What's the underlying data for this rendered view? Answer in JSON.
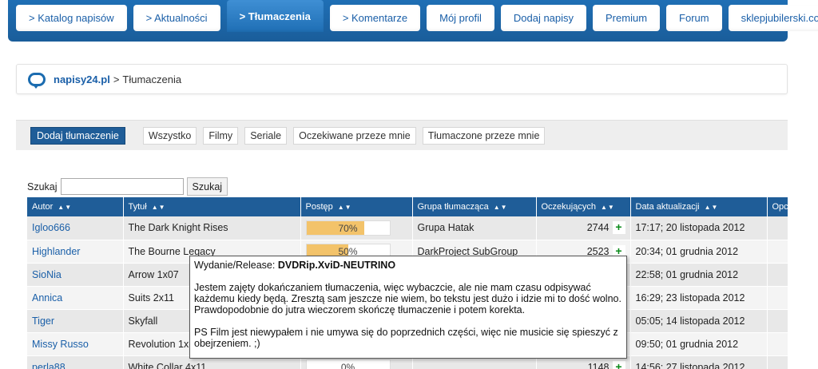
{
  "nav": {
    "tabs": [
      {
        "label": "> Katalog napisów",
        "active": false
      },
      {
        "label": "> Aktualności",
        "active": false
      },
      {
        "label": "> Tłumaczenia",
        "active": true
      },
      {
        "label": "> Komentarze",
        "active": false
      },
      {
        "label": "Mój profil",
        "active": false
      },
      {
        "label": "Dodaj napisy",
        "active": false
      },
      {
        "label": "Premium",
        "active": false
      },
      {
        "label": "Forum",
        "active": false
      },
      {
        "label": "sklepjubilerski.com",
        "active": false
      }
    ]
  },
  "breadcrumb": {
    "site": "napisy24.pl",
    "separator": ">",
    "current": "Tłumaczenia"
  },
  "filters": {
    "add_label": "Dodaj tłumaczenie",
    "items": [
      "Wszystko",
      "Filmy",
      "Seriale",
      "Oczekiwane przeze mnie",
      "Tłumaczone przeze mnie"
    ]
  },
  "search": {
    "label": "Szukaj",
    "value": "",
    "button": "Szukaj"
  },
  "table": {
    "columns": [
      "Autor",
      "Tytuł",
      "Postęp",
      "Grupa tłumacząca",
      "Oczekujących",
      "Data aktualizacji",
      "Opc"
    ],
    "rows": [
      {
        "author": "Igloo666",
        "title": "The Dark Knight Rises",
        "progress": 70,
        "progress_label": "70%",
        "group": "Grupa Hatak",
        "count": "2744",
        "date": "17:17; 20 listopada 2012"
      },
      {
        "author": "Highlander",
        "title": "The Bourne Legacy",
        "progress": 50,
        "progress_label": "50%",
        "group": "DarkProject SubGroup",
        "count": "2523",
        "date": "20:34; 01 grudnia 2012"
      },
      {
        "author": "SioNia",
        "title": "Arrow 1x07",
        "progress": 0,
        "progress_label": "",
        "group": "",
        "count": "",
        "date": "22:58; 01 grudnia 2012"
      },
      {
        "author": "Annica",
        "title": "Suits 2x11",
        "progress": 0,
        "progress_label": "",
        "group": "",
        "count": "",
        "date": "16:29; 23 listopada 2012"
      },
      {
        "author": "Tiger",
        "title": "Skyfall",
        "progress": 0,
        "progress_label": "",
        "group": "",
        "count": "",
        "date": "05:05; 14 listopada 2012"
      },
      {
        "author": "Missy Russo",
        "title": "Revolution 1x",
        "progress": 0,
        "progress_label": "",
        "group": "",
        "count": "",
        "date": "09:50; 01 grudnia 2012"
      },
      {
        "author": "perla88",
        "title": "White Collar 4x11",
        "progress": 0,
        "progress_label": "0%",
        "group": "",
        "count": "1148",
        "date": "14:56; 27 listopada 2012"
      }
    ]
  },
  "tooltip": {
    "release_label": "Wydanie/Release:",
    "release_value": "DVDRip.XviD-NEUTRINO",
    "paragraph1": "Jestem zajęty dokańczaniem tłumaczenia, więc wybaczcie, ale nie mam czasu odpisywać każdemu kiedy będą. Zresztą sam jeszcze nie wiem, bo tekstu jest dużo i idzie mi to dość wolno. Prawdopodobnie do jutra wieczorem skończę tłumaczenie i potem korekta.",
    "paragraph2": "PS Film jest niewypałem i nie umywa się do poprzednich części, więc nie musicie się spieszyć z obejrzeniem. ;)"
  },
  "colors": {
    "header_blue": "#1f5d98",
    "link_blue": "#1a5fa8",
    "progress_fill": "#f3c36a",
    "plus_green": "#0a8a1a"
  },
  "icons": {
    "logo": "speech-bubble-icon",
    "sort": "sort-arrows-icon",
    "add": "plus-icon"
  }
}
